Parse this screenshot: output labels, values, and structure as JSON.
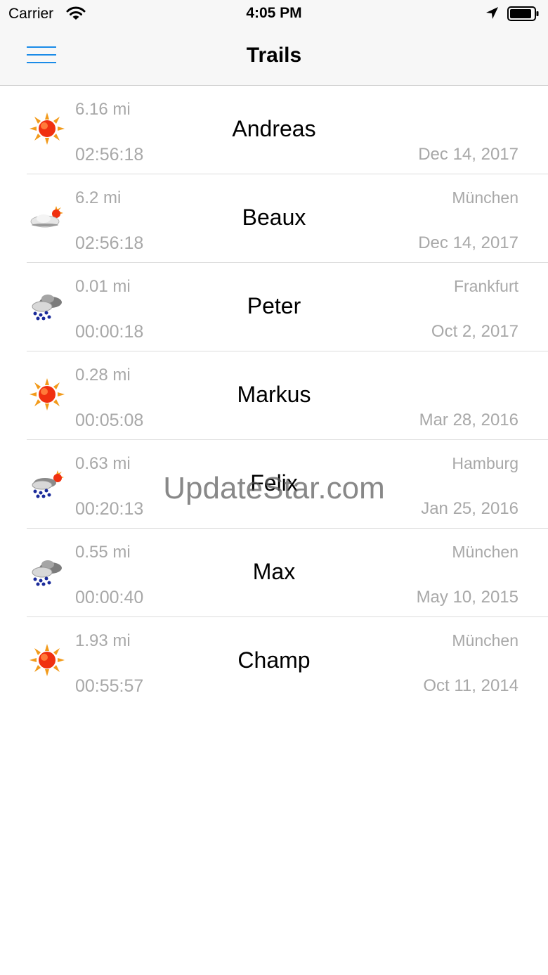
{
  "status_bar": {
    "carrier": "Carrier",
    "time": "4:05 PM",
    "icons": [
      "wifi-icon",
      "location-arrow-icon",
      "battery-icon"
    ]
  },
  "nav": {
    "title": "Trails",
    "menu_icon": "hamburger-menu-icon",
    "accent_color": "#1a8be8"
  },
  "trails": [
    {
      "icon": "sunny",
      "distance": "6.16 mi",
      "name": "Andreas",
      "city": "",
      "duration": "02:56:18",
      "date": "Dec 14, 2017"
    },
    {
      "icon": "cloudy-sun",
      "distance": "6.2 mi",
      "name": "Beaux",
      "city": "München",
      "duration": "02:56:18",
      "date": "Dec 14, 2017"
    },
    {
      "icon": "rain-cloud",
      "distance": "0.01 mi",
      "name": "Peter",
      "city": "Frankfurt",
      "duration": "00:00:18",
      "date": "Oct 2, 2017"
    },
    {
      "icon": "sunny",
      "distance": "0.28 mi",
      "name": "Markus",
      "city": "",
      "duration": "00:05:08",
      "date": "Mar 28, 2016"
    },
    {
      "icon": "rain-sun",
      "distance": "0.63 mi",
      "name": "Felix",
      "city": "Hamburg",
      "duration": "00:20:13",
      "date": "Jan 25, 2016"
    },
    {
      "icon": "rain-cloud",
      "distance": "0.55 mi",
      "name": "Max",
      "city": "München",
      "duration": "00:00:40",
      "date": "May 10, 2015"
    },
    {
      "icon": "sunny",
      "distance": "1.93 mi",
      "name": "Champ",
      "city": "München",
      "duration": "00:55:57",
      "date": "Oct 11, 2014"
    }
  ],
  "watermark": "UpdateStar.com"
}
